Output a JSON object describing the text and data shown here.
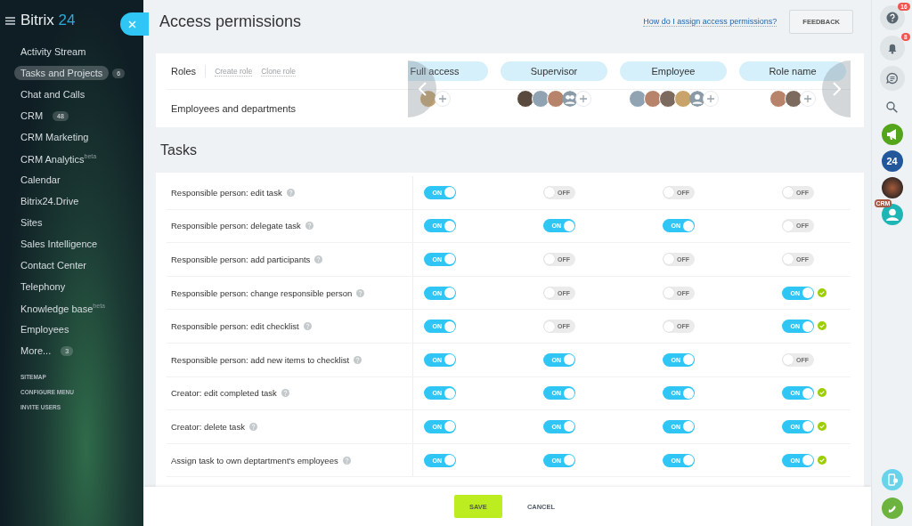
{
  "sidebar": {
    "logo": {
      "name": "Bitrix",
      "suffix": "24"
    },
    "items": [
      {
        "label": "Activity Stream",
        "selected": false
      },
      {
        "label": "Tasks and Projects",
        "selected": true,
        "badge": "6"
      },
      {
        "label": "Chat and Calls",
        "selected": false
      },
      {
        "label": "CRM",
        "selected": false,
        "badge": "48"
      },
      {
        "label": "CRM Marketing",
        "selected": false
      },
      {
        "label": "CRM Analytics$^{beta}$",
        "selected": false
      },
      {
        "label": "Calendar",
        "selected": false
      },
      {
        "label": "Bitrix24.Drive",
        "selected": false
      },
      {
        "label": "Sites",
        "selected": false
      },
      {
        "label": "Sales Intelligence",
        "selected": false
      },
      {
        "label": "Contact Center",
        "selected": false
      },
      {
        "label": "Telephony",
        "selected": false
      },
      {
        "label": "Knowledge base$^{beta}$",
        "selected": false
      },
      {
        "label": "Employees",
        "selected": false
      },
      {
        "label": "More...",
        "selected": false,
        "badge": "3"
      }
    ],
    "links": [
      "SITEMAP",
      "CONFIGURE MENU",
      "INVITE USERS"
    ]
  },
  "header": {
    "title": "Access permissions",
    "help_link": "How do I assign access permissions?",
    "feedback": "FEEDBACK"
  },
  "roles": {
    "label": "Roles",
    "actions": [
      "Create role",
      "Clone role"
    ],
    "members_label": "Employees and departments",
    "columns": [
      {
        "name": "Full access",
        "avatars": [
          {
            "kind": "photo"
          }
        ]
      },
      {
        "name": "Supervisor",
        "avatars": [
          {
            "kind": "photo"
          },
          {
            "kind": "photo"
          },
          {
            "kind": "photo"
          },
          {
            "kind": "group"
          }
        ]
      },
      {
        "name": "Employee",
        "avatars": [
          {
            "kind": "photo"
          },
          {
            "kind": "photo"
          },
          {
            "kind": "photo"
          },
          {
            "kind": "photo"
          },
          {
            "kind": "user"
          }
        ]
      },
      {
        "name": "Role name",
        "avatars": [
          {
            "kind": "photo"
          },
          {
            "kind": "photo"
          }
        ]
      }
    ]
  },
  "tasks": {
    "title": "Tasks",
    "rows": [
      {
        "label": "Responsible person: edit task",
        "cells": [
          {
            "on": true,
            "text": "ON",
            "changed": false
          },
          {
            "on": false,
            "text": "OFF",
            "changed": false
          },
          {
            "on": false,
            "text": "OFF",
            "changed": false
          },
          {
            "on": false,
            "text": "OFF",
            "changed": false
          }
        ]
      },
      {
        "label": "Responsible person: delegate task",
        "cells": [
          {
            "on": true,
            "text": "ON",
            "changed": false
          },
          {
            "on": true,
            "text": "ON",
            "changed": false
          },
          {
            "on": true,
            "text": "ON",
            "changed": false
          },
          {
            "on": false,
            "text": "OFF",
            "changed": false
          }
        ]
      },
      {
        "label": "Responsible person: add participants",
        "cells": [
          {
            "on": true,
            "text": "ON",
            "changed": false
          },
          {
            "on": false,
            "text": "OFF",
            "changed": false
          },
          {
            "on": false,
            "text": "OFF",
            "changed": false
          },
          {
            "on": false,
            "text": "OFF",
            "changed": false
          }
        ]
      },
      {
        "label": "Responsible person: change responsible person",
        "cells": [
          {
            "on": true,
            "text": "ON",
            "changed": false
          },
          {
            "on": false,
            "text": "OFF",
            "changed": false
          },
          {
            "on": false,
            "text": "OFF",
            "changed": false
          },
          {
            "on": true,
            "text": "ON",
            "changed": true
          }
        ]
      },
      {
        "label": "Responsible person: edit checklist",
        "cells": [
          {
            "on": true,
            "text": "ON",
            "changed": false
          },
          {
            "on": false,
            "text": "OFF",
            "changed": false
          },
          {
            "on": false,
            "text": "OFF",
            "changed": false
          },
          {
            "on": true,
            "text": "ON",
            "changed": true
          }
        ]
      },
      {
        "label": "Responsible person: add new items to checklist",
        "cells": [
          {
            "on": true,
            "text": "ON",
            "changed": false
          },
          {
            "on": true,
            "text": "ON",
            "changed": false
          },
          {
            "on": true,
            "text": "ON",
            "changed": false
          },
          {
            "on": false,
            "text": "OFF",
            "changed": false
          }
        ]
      },
      {
        "label": "Creator: edit completed task",
        "cells": [
          {
            "on": true,
            "text": "ON",
            "changed": false
          },
          {
            "on": true,
            "text": "ON",
            "changed": false
          },
          {
            "on": true,
            "text": "ON",
            "changed": false
          },
          {
            "on": true,
            "text": "ON",
            "changed": true
          }
        ]
      },
      {
        "label": "Creator: delete task",
        "cells": [
          {
            "on": true,
            "text": "ON",
            "changed": false
          },
          {
            "on": true,
            "text": "ON",
            "changed": false
          },
          {
            "on": true,
            "text": "ON",
            "changed": false
          },
          {
            "on": true,
            "text": "ON",
            "changed": true
          }
        ]
      },
      {
        "label": "Assign task to own deptartment's employees",
        "cells": [
          {
            "on": true,
            "text": "ON",
            "changed": false
          },
          {
            "on": true,
            "text": "ON",
            "changed": false
          },
          {
            "on": true,
            "text": "ON",
            "changed": false
          },
          {
            "on": true,
            "text": "ON",
            "changed": true
          }
        ]
      }
    ]
  },
  "footer": {
    "buttons": [
      {
        "label": "SAVE",
        "kind": "primary"
      },
      {
        "label": "CANCEL",
        "kind": "link"
      }
    ]
  },
  "rightbar": {
    "help_badge": "16",
    "bell_badge": "8",
    "app_label": "24",
    "crm_badge": "CRM"
  }
}
